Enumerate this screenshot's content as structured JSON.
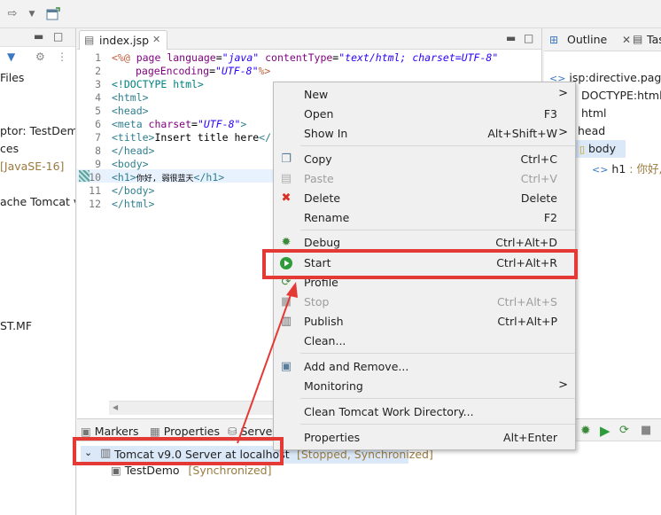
{
  "toolbar": {
    "icons": [
      "forward-arrow-icon",
      "dropdown-arrow-icon",
      "open-perspective-icon"
    ]
  },
  "left_panel": {
    "lines": [
      {
        "text": "Files",
        "muted": ""
      },
      {
        "text": "ptor: TestDem",
        "muted": ""
      },
      {
        "text": "ces",
        "muted": ""
      },
      {
        "text": "",
        "muted": "[JavaSE-16]"
      },
      {
        "text": "ache Tomcat v",
        "muted": ""
      },
      {
        "text": "ST.MF",
        "muted": ""
      }
    ]
  },
  "editor": {
    "tab_label": "index.jsp",
    "lines": [
      {
        "n": "1"
      },
      {
        "n": "2"
      },
      {
        "n": "3"
      },
      {
        "n": "4"
      },
      {
        "n": "5"
      },
      {
        "n": "6"
      },
      {
        "n": "7"
      },
      {
        "n": "8"
      },
      {
        "n": "9"
      },
      {
        "n": "10"
      },
      {
        "n": "11"
      },
      {
        "n": "12"
      }
    ],
    "code": {
      "l1_open": "<%@ ",
      "l1_page": "page ",
      "l1_lang_attr": "language",
      "l1_eq": "=",
      "l1_lang_val": "\"java\"",
      "l1_ct_attr": " contentType",
      "l1_ct_val": "\"text/html; charset=UTF-8\"",
      "l2_pe_attr": "pageEncoding",
      "l2_pe_val": "\"UTF-8\"",
      "l2_close": "%>",
      "l3": "<!DOCTYPE html>",
      "l4": "<html>",
      "l5": "<head>",
      "l6_tag": "<meta ",
      "l6_attr": "charset",
      "l6_val": "\"UTF-8\"",
      "l6_close": ">",
      "l7_open": "<title>",
      "l7_text": "Insert title here",
      "l7_close": "</",
      "l8": "</head>",
      "l9": "<body>",
      "l10_open": "<h1>",
      "l10_text": "你好, 弱很蓝天",
      "l10_close": "</h1>",
      "l11": "</body>",
      "l12": "</html>"
    }
  },
  "outline": {
    "tab_label": "Outline",
    "tab2_label": "Tas",
    "items": [
      {
        "label": "jsp:directive.pag"
      },
      {
        "label": "DOCTYPE:html"
      },
      {
        "label": "html"
      },
      {
        "label": "head"
      },
      {
        "label": "body"
      },
      {
        "label": "h1",
        "extra": " : 你好,"
      }
    ]
  },
  "bottom": {
    "tabs": [
      "Markers",
      "Properties",
      "Serve"
    ],
    "server_name": "Tomcat v9.0 Server at localhost",
    "server_status": "[Stopped, Synchronized]",
    "project_name": "TestDemo",
    "project_status": "[Synchronized]"
  },
  "context_menu": {
    "items": [
      {
        "label": "New",
        "shortcut": "",
        "submenu": ">"
      },
      {
        "label": "Open",
        "shortcut": "F3"
      },
      {
        "label": "Show In",
        "shortcut": "Alt+Shift+W",
        "submenu": ">"
      },
      {
        "label": "Copy",
        "shortcut": "Ctrl+C"
      },
      {
        "label": "Paste",
        "shortcut": "Ctrl+V"
      },
      {
        "label": "Delete",
        "shortcut": "Delete"
      },
      {
        "label": "Rename",
        "shortcut": "F2"
      },
      {
        "label": "Debug",
        "shortcut": "Ctrl+Alt+D"
      },
      {
        "label": "Start",
        "shortcut": "Ctrl+Alt+R"
      },
      {
        "label": "Profile",
        "shortcut": ""
      },
      {
        "label": "Stop",
        "shortcut": "Ctrl+Alt+S"
      },
      {
        "label": "Publish",
        "shortcut": "Ctrl+Alt+P"
      },
      {
        "label": "Clean...",
        "shortcut": ""
      },
      {
        "label": "Add and Remove...",
        "shortcut": ""
      },
      {
        "label": "Monitoring",
        "shortcut": "",
        "submenu": ">"
      },
      {
        "label": "Clean Tomcat Work Directory...",
        "shortcut": ""
      },
      {
        "label": "Properties",
        "shortcut": "Alt+Enter"
      }
    ]
  },
  "colors": {
    "highlight_red": "#e53935",
    "start_green": "#2e9b3a",
    "delete_red": "#d93025"
  }
}
